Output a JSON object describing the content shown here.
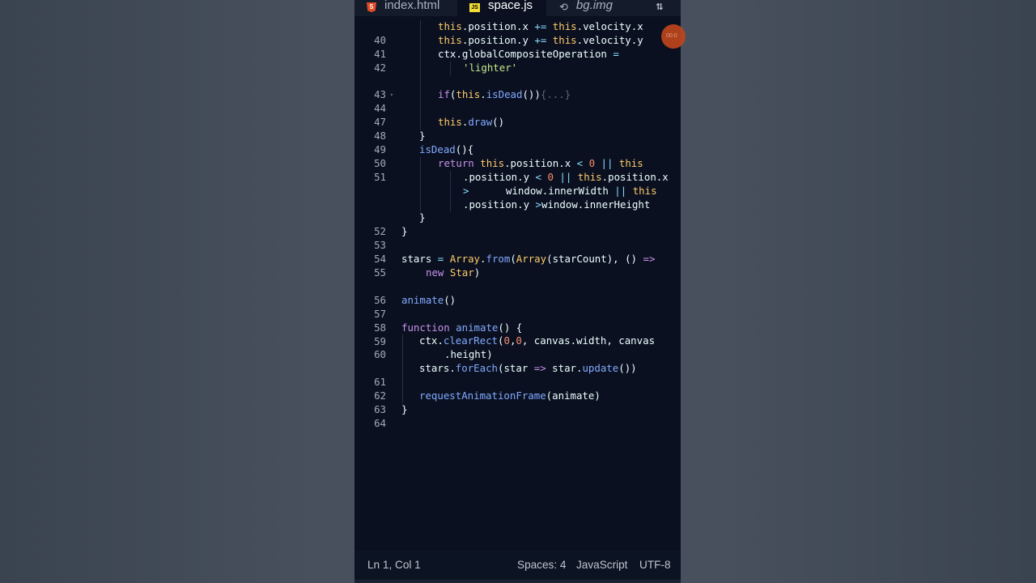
{
  "tabs": [
    {
      "label": "index.html",
      "icon": "html5-icon",
      "active": false
    },
    {
      "label": "space.js",
      "icon": "javascript-icon",
      "active": true
    },
    {
      "label": "bg.img",
      "icon": "image-file-icon",
      "active": false
    }
  ],
  "code_lines": [
    {
      "n": "40"
    },
    {
      "n": "41"
    },
    {
      "n": "42"
    },
    {
      "n": ""
    },
    {
      "n": "43"
    },
    {
      "n": "44"
    },
    {
      "n": "47"
    },
    {
      "n": "48"
    },
    {
      "n": "49"
    },
    {
      "n": "50"
    },
    {
      "n": "51"
    },
    {
      "n": ""
    },
    {
      "n": ""
    },
    {
      "n": ""
    },
    {
      "n": "52"
    },
    {
      "n": "53"
    },
    {
      "n": "54"
    },
    {
      "n": "55"
    },
    {
      "n": ""
    },
    {
      "n": "56"
    },
    {
      "n": "57"
    },
    {
      "n": "58"
    },
    {
      "n": "59"
    },
    {
      "n": "60"
    },
    {
      "n": ""
    },
    {
      "n": "61"
    },
    {
      "n": "62"
    },
    {
      "n": "63"
    },
    {
      "n": "64"
    }
  ],
  "code": {
    "this": "this",
    "position": "position",
    "velocity": "velocity",
    "x": "x",
    "y": "y",
    "ctx": "ctx",
    "globalCompositeOperation": "globalCompositeOperation",
    "lighter": "'lighter'",
    "if": "if",
    "isDead": "isDead",
    "folded": "{...}",
    "draw": "draw",
    "return": "return",
    "window": "window",
    "innerWidth": "innerWidth",
    "innerHeight": "innerHeight",
    "stars": "stars",
    "Array": "Array",
    "from": "from",
    "starCount": "starCount",
    "new": "new",
    "Star": "Star",
    "animate": "animate",
    "function": "function",
    "clearRect": "clearRect",
    "zero": "0",
    "canvas": "canvas",
    "width": "width",
    "height": "height",
    "forEach": "forEach",
    "star": "star",
    "update": "update",
    "requestAnimationFrame": "requestAnimationFrame"
  },
  "status": {
    "position": "Ln 1, Col 1",
    "spaces": "Spaces: 4",
    "language": "JavaScript",
    "encoding": "UTF-8"
  },
  "recording_badge": "00:0",
  "colors": {
    "editor_bg": "#0a1020",
    "keyword": "#c792ea",
    "string": "#c3e88d",
    "function": "#82aaff",
    "class": "#ffcb6b",
    "operator": "#89ddff",
    "number": "#f78c6c"
  }
}
